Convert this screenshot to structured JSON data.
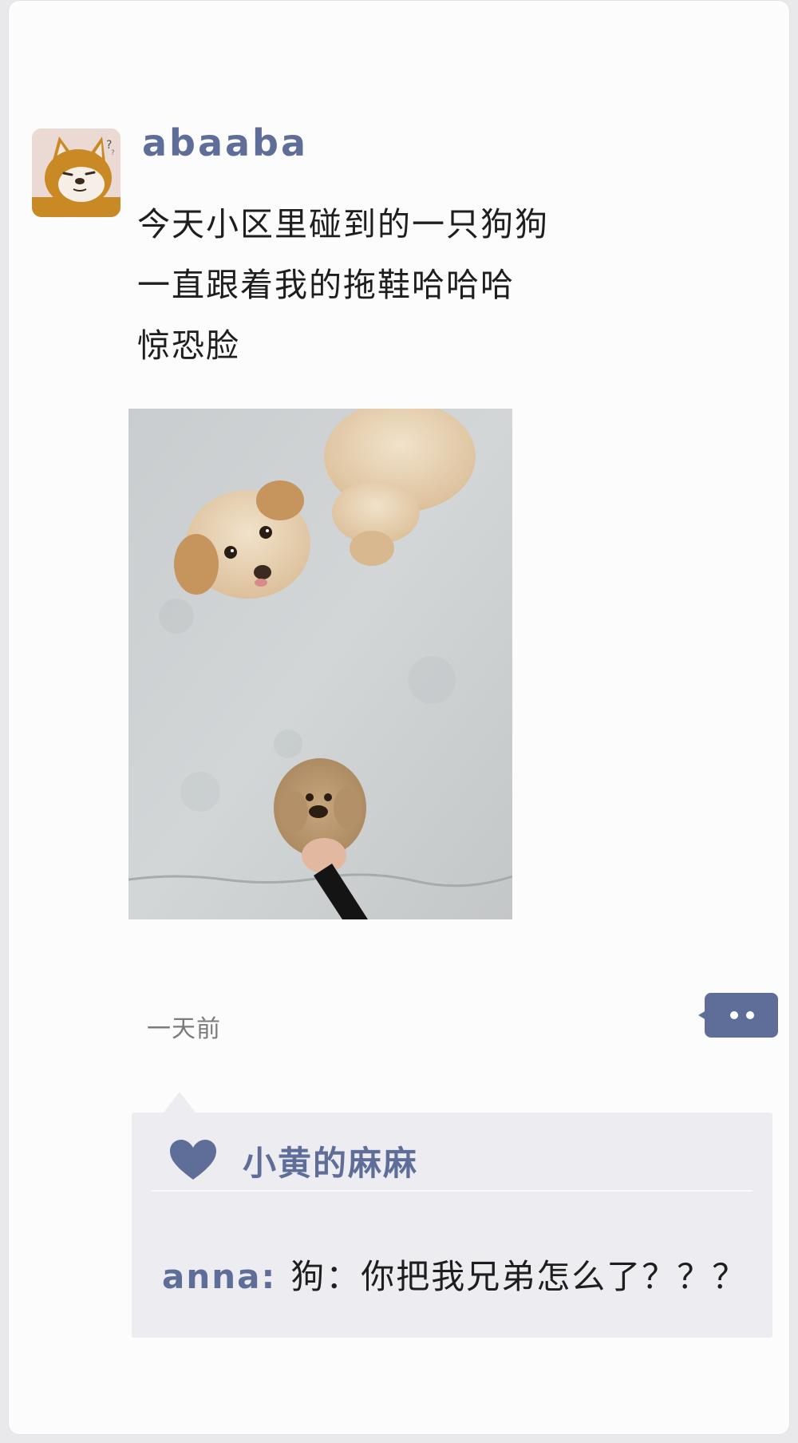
{
  "post": {
    "username": "abaaba",
    "text_lines": [
      "今天小区里碰到的一只狗狗",
      "一直跟着我的拖鞋哈哈哈",
      "惊恐脸"
    ],
    "timestamp": "一天前"
  },
  "likes": {
    "icon": "heart-icon",
    "names": "小黄的麻麻"
  },
  "comments": [
    {
      "author": "anna",
      "separator": ":",
      "text": "狗：你把我兄弟怎么了？？？"
    }
  ],
  "colors": {
    "accent": "#5f6d99",
    "comment_bg": "#ececf1",
    "text": "#1e1e1e",
    "muted": "#7b7b7b"
  }
}
